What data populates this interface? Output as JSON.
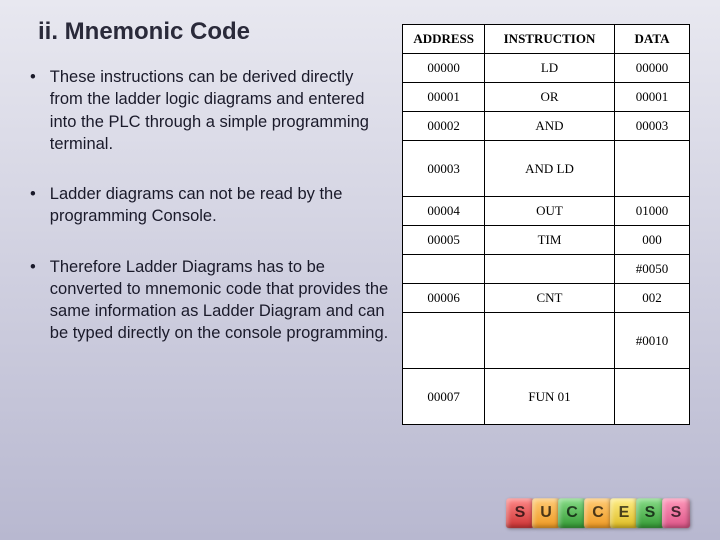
{
  "title": "ii. Mnemonic Code",
  "bullets": [
    "These instructions can be derived directly from the ladder logic diagrams and entered into the PLC through a simple programming terminal.",
    "Ladder diagrams can not be read by the programming Console.",
    "Therefore Ladder Diagrams has to be converted to mnemonic code that provides the same information as Ladder Diagram and can be typed directly on the console programming."
  ],
  "table": {
    "headers": [
      "ADDRESS",
      "INSTRUCTION",
      "DATA"
    ],
    "rows": [
      {
        "addr": "00000",
        "instr": "LD",
        "data": "00000",
        "tall": false
      },
      {
        "addr": "00001",
        "instr": "OR",
        "data": "00001",
        "tall": false
      },
      {
        "addr": "00002",
        "instr": "AND",
        "data": "00003",
        "tall": false
      },
      {
        "addr": "00003",
        "instr": "AND LD",
        "data": "",
        "tall": true
      },
      {
        "addr": "00004",
        "instr": "OUT",
        "data": "01000",
        "tall": false
      },
      {
        "addr": "00005",
        "instr": "TIM",
        "data": "000",
        "tall": false
      },
      {
        "addr": "",
        "instr": "",
        "data": "#0050",
        "tall": false
      },
      {
        "addr": "00006",
        "instr": "CNT",
        "data": "002",
        "tall": false
      },
      {
        "addr": "",
        "instr": "",
        "data": "#0010",
        "tall": true
      },
      {
        "addr": "00007",
        "instr": "FUN 01",
        "data": "",
        "tall": true
      }
    ]
  },
  "blocks": [
    "S",
    "U",
    "C",
    "C",
    "E",
    "S",
    "S"
  ]
}
